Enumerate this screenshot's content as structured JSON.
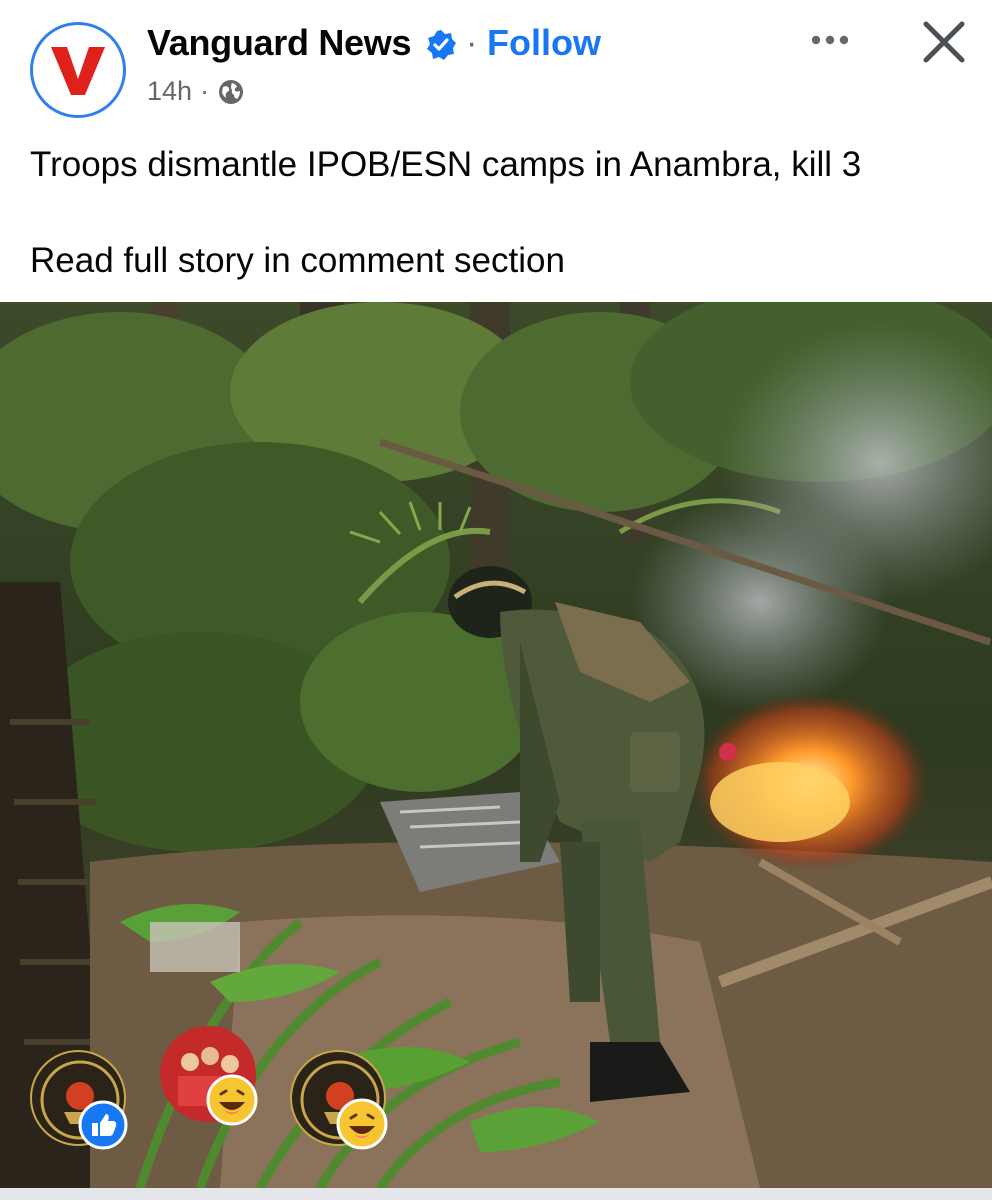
{
  "post": {
    "page_name": "Vanguard News",
    "follow_label": "Follow",
    "time": "14h",
    "separator": "·",
    "audience_icon": "globe-icon",
    "verified_icon": "verified-badge-icon",
    "text_line1": "Troops dismantle IPOB/ESN camps in Anambra, kill 3",
    "text_line2": "Read full story in comment section"
  },
  "toolbar": {
    "more_icon": "more-options-icon",
    "close_icon": "close-icon"
  },
  "reactions": [
    {
      "type": "like",
      "icon": "like-reaction-icon"
    },
    {
      "type": "haha",
      "icon": "haha-reaction-icon"
    },
    {
      "type": "haha",
      "icon": "haha-reaction-icon"
    }
  ],
  "colors": {
    "brand_blue": "#1877f2",
    "logo_red": "#e0201b",
    "meta_gray": "#65676b"
  }
}
